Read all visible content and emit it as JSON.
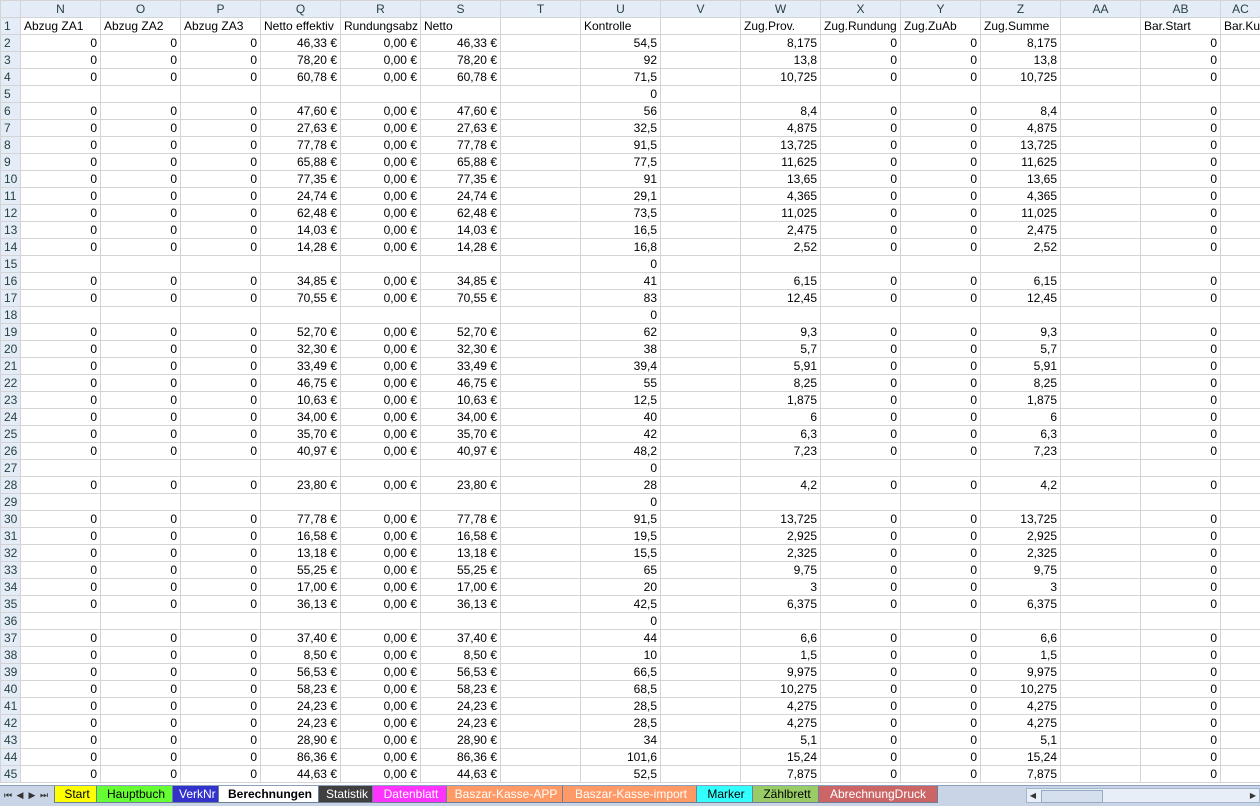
{
  "columns": [
    {
      "letter": "N",
      "header": "Abzug ZA1"
    },
    {
      "letter": "O",
      "header": "Abzug ZA2"
    },
    {
      "letter": "P",
      "header": "Abzug ZA3"
    },
    {
      "letter": "Q",
      "header": "Netto effektiv"
    },
    {
      "letter": "R",
      "header": "Rundungsabz"
    },
    {
      "letter": "S",
      "header": "Netto"
    },
    {
      "letter": "T",
      "header": ""
    },
    {
      "letter": "U",
      "header": "Kontrolle"
    },
    {
      "letter": "V",
      "header": ""
    },
    {
      "letter": "W",
      "header": "Zug.Prov."
    },
    {
      "letter": "X",
      "header": "Zug.Rundung"
    },
    {
      "letter": "Y",
      "header": "Zug.ZuAb"
    },
    {
      "letter": "Z",
      "header": "Zug.Summe"
    },
    {
      "letter": "AA",
      "header": ""
    },
    {
      "letter": "AB",
      "header": "Bar.Start"
    },
    {
      "letter": "AC",
      "header": "Bar.Ku"
    }
  ],
  "rows": [
    {
      "n": 2,
      "c": [
        "0",
        "0",
        "0",
        "46,33 €",
        "0,00 €",
        "46,33 €",
        "",
        "54,5",
        "",
        "8,175",
        "0",
        "0",
        "8,175",
        "",
        "0",
        ""
      ]
    },
    {
      "n": 3,
      "c": [
        "0",
        "0",
        "0",
        "78,20 €",
        "0,00 €",
        "78,20 €",
        "",
        "92",
        "",
        "13,8",
        "0",
        "0",
        "13,8",
        "",
        "0",
        ""
      ]
    },
    {
      "n": 4,
      "c": [
        "0",
        "0",
        "0",
        "60,78 €",
        "0,00 €",
        "60,78 €",
        "",
        "71,5",
        "",
        "10,725",
        "0",
        "0",
        "10,725",
        "",
        "0",
        ""
      ]
    },
    {
      "n": 5,
      "c": [
        "",
        "",
        "",
        "",
        "",
        "",
        "",
        "0",
        "",
        "",
        "",
        "",
        "",
        "",
        "",
        ""
      ]
    },
    {
      "n": 6,
      "c": [
        "0",
        "0",
        "0",
        "47,60 €",
        "0,00 €",
        "47,60 €",
        "",
        "56",
        "",
        "8,4",
        "0",
        "0",
        "8,4",
        "",
        "0",
        ""
      ]
    },
    {
      "n": 7,
      "c": [
        "0",
        "0",
        "0",
        "27,63 €",
        "0,00 €",
        "27,63 €",
        "",
        "32,5",
        "",
        "4,875",
        "0",
        "0",
        "4,875",
        "",
        "0",
        ""
      ]
    },
    {
      "n": 8,
      "c": [
        "0",
        "0",
        "0",
        "77,78 €",
        "0,00 €",
        "77,78 €",
        "",
        "91,5",
        "",
        "13,725",
        "0",
        "0",
        "13,725",
        "",
        "0",
        ""
      ]
    },
    {
      "n": 9,
      "c": [
        "0",
        "0",
        "0",
        "65,88 €",
        "0,00 €",
        "65,88 €",
        "",
        "77,5",
        "",
        "11,625",
        "0",
        "0",
        "11,625",
        "",
        "0",
        ""
      ]
    },
    {
      "n": 10,
      "c": [
        "0",
        "0",
        "0",
        "77,35 €",
        "0,00 €",
        "77,35 €",
        "",
        "91",
        "",
        "13,65",
        "0",
        "0",
        "13,65",
        "",
        "0",
        ""
      ]
    },
    {
      "n": 11,
      "c": [
        "0",
        "0",
        "0",
        "24,74 €",
        "0,00 €",
        "24,74 €",
        "",
        "29,1",
        "",
        "4,365",
        "0",
        "0",
        "4,365",
        "",
        "0",
        ""
      ]
    },
    {
      "n": 12,
      "c": [
        "0",
        "0",
        "0",
        "62,48 €",
        "0,00 €",
        "62,48 €",
        "",
        "73,5",
        "",
        "11,025",
        "0",
        "0",
        "11,025",
        "",
        "0",
        ""
      ]
    },
    {
      "n": 13,
      "c": [
        "0",
        "0",
        "0",
        "14,03 €",
        "0,00 €",
        "14,03 €",
        "",
        "16,5",
        "",
        "2,475",
        "0",
        "0",
        "2,475",
        "",
        "0",
        ""
      ]
    },
    {
      "n": 14,
      "c": [
        "0",
        "0",
        "0",
        "14,28 €",
        "0,00 €",
        "14,28 €",
        "",
        "16,8",
        "",
        "2,52",
        "0",
        "0",
        "2,52",
        "",
        "0",
        ""
      ]
    },
    {
      "n": 15,
      "c": [
        "",
        "",
        "",
        "",
        "",
        "",
        "",
        "0",
        "",
        "",
        "",
        "",
        "",
        "",
        "",
        ""
      ]
    },
    {
      "n": 16,
      "c": [
        "0",
        "0",
        "0",
        "34,85 €",
        "0,00 €",
        "34,85 €",
        "",
        "41",
        "",
        "6,15",
        "0",
        "0",
        "6,15",
        "",
        "0",
        ""
      ]
    },
    {
      "n": 17,
      "c": [
        "0",
        "0",
        "0",
        "70,55 €",
        "0,00 €",
        "70,55 €",
        "",
        "83",
        "",
        "12,45",
        "0",
        "0",
        "12,45",
        "",
        "0",
        ""
      ]
    },
    {
      "n": 18,
      "c": [
        "",
        "",
        "",
        "",
        "",
        "",
        "",
        "0",
        "",
        "",
        "",
        "",
        "",
        "",
        "",
        ""
      ]
    },
    {
      "n": 19,
      "c": [
        "0",
        "0",
        "0",
        "52,70 €",
        "0,00 €",
        "52,70 €",
        "",
        "62",
        "",
        "9,3",
        "0",
        "0",
        "9,3",
        "",
        "0",
        ""
      ]
    },
    {
      "n": 20,
      "c": [
        "0",
        "0",
        "0",
        "32,30 €",
        "0,00 €",
        "32,30 €",
        "",
        "38",
        "",
        "5,7",
        "0",
        "0",
        "5,7",
        "",
        "0",
        ""
      ]
    },
    {
      "n": 21,
      "c": [
        "0",
        "0",
        "0",
        "33,49 €",
        "0,00 €",
        "33,49 €",
        "",
        "39,4",
        "",
        "5,91",
        "0",
        "0",
        "5,91",
        "",
        "0",
        ""
      ]
    },
    {
      "n": 22,
      "c": [
        "0",
        "0",
        "0",
        "46,75 €",
        "0,00 €",
        "46,75 €",
        "",
        "55",
        "",
        "8,25",
        "0",
        "0",
        "8,25",
        "",
        "0",
        ""
      ]
    },
    {
      "n": 23,
      "c": [
        "0",
        "0",
        "0",
        "10,63 €",
        "0,00 €",
        "10,63 €",
        "",
        "12,5",
        "",
        "1,875",
        "0",
        "0",
        "1,875",
        "",
        "0",
        ""
      ]
    },
    {
      "n": 24,
      "c": [
        "0",
        "0",
        "0",
        "34,00 €",
        "0,00 €",
        "34,00 €",
        "",
        "40",
        "",
        "6",
        "0",
        "0",
        "6",
        "",
        "0",
        ""
      ]
    },
    {
      "n": 25,
      "c": [
        "0",
        "0",
        "0",
        "35,70 €",
        "0,00 €",
        "35,70 €",
        "",
        "42",
        "",
        "6,3",
        "0",
        "0",
        "6,3",
        "",
        "0",
        ""
      ]
    },
    {
      "n": 26,
      "c": [
        "0",
        "0",
        "0",
        "40,97 €",
        "0,00 €",
        "40,97 €",
        "",
        "48,2",
        "",
        "7,23",
        "0",
        "0",
        "7,23",
        "",
        "0",
        ""
      ]
    },
    {
      "n": 27,
      "c": [
        "",
        "",
        "",
        "",
        "",
        "",
        "",
        "0",
        "",
        "",
        "",
        "",
        "",
        "",
        "",
        ""
      ]
    },
    {
      "n": 28,
      "c": [
        "0",
        "0",
        "0",
        "23,80 €",
        "0,00 €",
        "23,80 €",
        "",
        "28",
        "",
        "4,2",
        "0",
        "0",
        "4,2",
        "",
        "0",
        ""
      ]
    },
    {
      "n": 29,
      "c": [
        "",
        "",
        "",
        "",
        "",
        "",
        "",
        "0",
        "",
        "",
        "",
        "",
        "",
        "",
        "",
        ""
      ]
    },
    {
      "n": 30,
      "c": [
        "0",
        "0",
        "0",
        "77,78 €",
        "0,00 €",
        "77,78 €",
        "",
        "91,5",
        "",
        "13,725",
        "0",
        "0",
        "13,725",
        "",
        "0",
        ""
      ]
    },
    {
      "n": 31,
      "c": [
        "0",
        "0",
        "0",
        "16,58 €",
        "0,00 €",
        "16,58 €",
        "",
        "19,5",
        "",
        "2,925",
        "0",
        "0",
        "2,925",
        "",
        "0",
        ""
      ]
    },
    {
      "n": 32,
      "c": [
        "0",
        "0",
        "0",
        "13,18 €",
        "0,00 €",
        "13,18 €",
        "",
        "15,5",
        "",
        "2,325",
        "0",
        "0",
        "2,325",
        "",
        "0",
        ""
      ]
    },
    {
      "n": 33,
      "c": [
        "0",
        "0",
        "0",
        "55,25 €",
        "0,00 €",
        "55,25 €",
        "",
        "65",
        "",
        "9,75",
        "0",
        "0",
        "9,75",
        "",
        "0",
        ""
      ]
    },
    {
      "n": 34,
      "c": [
        "0",
        "0",
        "0",
        "17,00 €",
        "0,00 €",
        "17,00 €",
        "",
        "20",
        "",
        "3",
        "0",
        "0",
        "3",
        "",
        "0",
        ""
      ]
    },
    {
      "n": 35,
      "c": [
        "0",
        "0",
        "0",
        "36,13 €",
        "0,00 €",
        "36,13 €",
        "",
        "42,5",
        "",
        "6,375",
        "0",
        "0",
        "6,375",
        "",
        "0",
        ""
      ]
    },
    {
      "n": 36,
      "c": [
        "",
        "",
        "",
        "",
        "",
        "",
        "",
        "0",
        "",
        "",
        "",
        "",
        "",
        "",
        "",
        ""
      ]
    },
    {
      "n": 37,
      "c": [
        "0",
        "0",
        "0",
        "37,40 €",
        "0,00 €",
        "37,40 €",
        "",
        "44",
        "",
        "6,6",
        "0",
        "0",
        "6,6",
        "",
        "0",
        ""
      ]
    },
    {
      "n": 38,
      "c": [
        "0",
        "0",
        "0",
        "8,50 €",
        "0,00 €",
        "8,50 €",
        "",
        "10",
        "",
        "1,5",
        "0",
        "0",
        "1,5",
        "",
        "0",
        ""
      ]
    },
    {
      "n": 39,
      "c": [
        "0",
        "0",
        "0",
        "56,53 €",
        "0,00 €",
        "56,53 €",
        "",
        "66,5",
        "",
        "9,975",
        "0",
        "0",
        "9,975",
        "",
        "0",
        ""
      ]
    },
    {
      "n": 40,
      "c": [
        "0",
        "0",
        "0",
        "58,23 €",
        "0,00 €",
        "58,23 €",
        "",
        "68,5",
        "",
        "10,275",
        "0",
        "0",
        "10,275",
        "",
        "0",
        ""
      ]
    },
    {
      "n": 41,
      "c": [
        "0",
        "0",
        "0",
        "24,23 €",
        "0,00 €",
        "24,23 €",
        "",
        "28,5",
        "",
        "4,275",
        "0",
        "0",
        "4,275",
        "",
        "0",
        ""
      ]
    },
    {
      "n": 42,
      "c": [
        "0",
        "0",
        "0",
        "24,23 €",
        "0,00 €",
        "24,23 €",
        "",
        "28,5",
        "",
        "4,275",
        "0",
        "0",
        "4,275",
        "",
        "0",
        ""
      ]
    },
    {
      "n": 43,
      "c": [
        "0",
        "0",
        "0",
        "28,90 €",
        "0,00 €",
        "28,90 €",
        "",
        "34",
        "",
        "5,1",
        "0",
        "0",
        "5,1",
        "",
        "0",
        ""
      ]
    },
    {
      "n": 44,
      "c": [
        "0",
        "0",
        "0",
        "86,36 €",
        "0,00 €",
        "86,36 €",
        "",
        "101,6",
        "",
        "15,24",
        "0",
        "0",
        "15,24",
        "",
        "0",
        ""
      ]
    },
    {
      "n": 45,
      "c": [
        "0",
        "0",
        "0",
        "44,63 €",
        "0,00 €",
        "44,63 €",
        "",
        "52,5",
        "",
        "7,875",
        "0",
        "0",
        "7,875",
        "",
        "0",
        ""
      ]
    }
  ],
  "header_row_number": "1",
  "sheet_tabs": [
    {
      "label": "Start",
      "color": "#ffff00"
    },
    {
      "label": "Hauptbuch",
      "color": "#66ff33"
    },
    {
      "label": "VerkNr",
      "color": "#3333cc"
    },
    {
      "label": "Berechnungen",
      "color": "#ffffff",
      "active": true
    },
    {
      "label": "Statistik",
      "color": "#404040"
    },
    {
      "label": "Datenblatt",
      "color": "#ff33ff"
    },
    {
      "label": "Baszar-Kasse-APP",
      "color": "#ff9966"
    },
    {
      "label": "Baszar-Kasse-import",
      "color": "#ff9966"
    },
    {
      "label": "Marker",
      "color": "#33ffff"
    },
    {
      "label": "Zählbrett",
      "color": "#99cc66"
    },
    {
      "label": "AbrechnungDruck",
      "color": "#cc6666"
    }
  ],
  "tab_nav_icons": [
    "first-sheet-icon",
    "prev-sheet-icon",
    "next-sheet-icon",
    "last-sheet-icon"
  ]
}
